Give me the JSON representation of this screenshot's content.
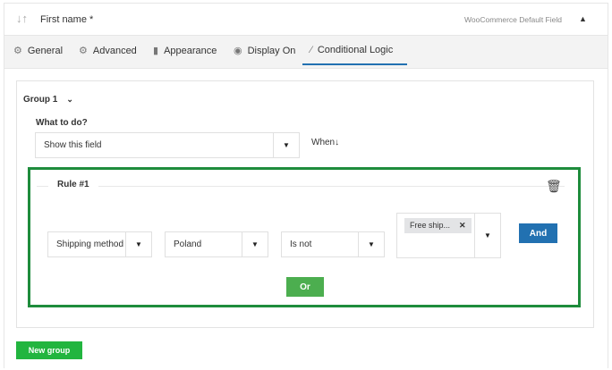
{
  "header": {
    "title": "First name *",
    "field_type": "WooCommerce Default Field"
  },
  "tabs": [
    {
      "label": "General",
      "icon": "gear-icon"
    },
    {
      "label": "Advanced",
      "icon": "gears-icon"
    },
    {
      "label": "Appearance",
      "icon": "brush-icon"
    },
    {
      "label": "Display On",
      "icon": "eye-icon"
    },
    {
      "label": "Conditional Logic",
      "icon": "magic-wand-icon",
      "active": true
    }
  ],
  "group": {
    "title": "Group 1",
    "what_label": "What to do?",
    "action": "Show this field",
    "when": "When"
  },
  "rule": {
    "title": "Rule #1",
    "field": "Shipping method",
    "value": "Poland",
    "operator": "Is not",
    "tag": "Free ship...",
    "and": "And",
    "or": "Or"
  },
  "new_group": "New group",
  "colors": {
    "accent": "#2271b1",
    "green": "#1e8c3c",
    "button_green": "#4cae4f"
  }
}
